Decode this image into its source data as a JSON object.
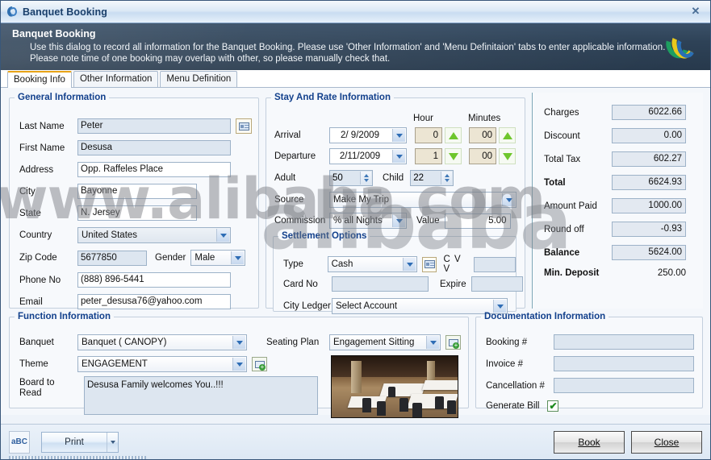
{
  "window": {
    "title": "Banquet Booking",
    "close_label": "✕",
    "logo_icon": "crescent-logo-icon"
  },
  "banner": {
    "heading": "Banquet Booking",
    "line1": "Use this dialog to record all information for the Banquet Booking. Please use 'Other Information' and 'Menu Definitaion' tabs to enter applicable information.",
    "line2": "Please note time of one booking may overlap with other, so please manually check that."
  },
  "tabs": [
    {
      "label": "Booking Info",
      "active": true
    },
    {
      "label": "Other Information",
      "active": false
    },
    {
      "label": "Menu Definition",
      "active": false
    }
  ],
  "general_information": {
    "legend": "General Information",
    "labels": {
      "last_name": "Last Name",
      "first_name": "First Name",
      "address": "Address",
      "city": "City",
      "state": "State",
      "country": "Country",
      "zip_code": "Zip Code",
      "gender": "Gender",
      "phone_no": "Phone No",
      "email": "Email"
    },
    "values": {
      "last_name": "Peter",
      "first_name": "Desusa",
      "address": "Opp. Raffeles Place",
      "city": "Bayonne",
      "state": "N. Jersey",
      "country": "United States",
      "zip_code": "5677850",
      "gender": "Male",
      "phone_no": "(888) 896-5441",
      "email": "peter_desusa76@yahoo.com"
    },
    "lookup_icon": "address-card-lookup-icon"
  },
  "stay_and_rate": {
    "legend": "Stay And Rate Information",
    "column_headers": {
      "hour": "Hour",
      "minutes": "Minutes"
    },
    "labels": {
      "arrival": "Arrival",
      "departure": "Departure",
      "adult": "Adult",
      "child": "Child",
      "source": "Source",
      "commission": "Commission",
      "value": "Value"
    },
    "values": {
      "arrival_date": "2/ 9/2009",
      "arrival_hour": "0",
      "arrival_minutes": "00",
      "departure_date": "2/11/2009",
      "departure_hour": "1",
      "departure_minutes": "00",
      "adult": "50",
      "child": "22",
      "source": "Make My Trip",
      "commission": "% all Nights",
      "value": "5.00"
    }
  },
  "settlement": {
    "legend": "Settlement Options",
    "labels": {
      "type": "Type",
      "cvv": "C V V",
      "card_no": "Card No",
      "expire": "Expire",
      "city_ledger": "City Ledger"
    },
    "values": {
      "type": "Cash",
      "cvv": "",
      "card_no": "",
      "expire": "",
      "city_ledger": "Select Account"
    },
    "card_icon": "credit-card-icon"
  },
  "charges_panel": {
    "rows": [
      {
        "label": "Charges",
        "value": "6022.66",
        "bold": false
      },
      {
        "label": "Discount",
        "value": "0.00",
        "bold": false
      },
      {
        "label": "Total Tax",
        "value": "602.27",
        "bold": false
      },
      {
        "label": "Total",
        "value": "6624.93",
        "bold": true
      },
      {
        "label": "Amount Paid",
        "value": "1000.00",
        "bold": false
      },
      {
        "label": "Round off",
        "value": "-0.93",
        "bold": false
      },
      {
        "label": "Balance",
        "value": "5624.00",
        "bold": true
      }
    ],
    "min_deposit": {
      "label": "Min. Deposit",
      "value": "250.00"
    }
  },
  "function_information": {
    "legend": "Function Information",
    "labels": {
      "banquet": "Banquet",
      "theme": "Theme",
      "board_to_read": "Board to Read",
      "seating_plan": "Seating Plan"
    },
    "values": {
      "banquet": "Banquet ( CANOPY)",
      "theme": "ENGAGEMENT",
      "board_to_read": "Desusa Family welcomes You..!!!",
      "seating_plan": "Engagement Sitting"
    },
    "theme_add_icon": "add-theme-icon",
    "seating_add_icon": "add-seating-plan-icon",
    "seating_photo_alt": "banquet-hall-photo"
  },
  "documentation_information": {
    "legend": "Documentation Information",
    "labels": {
      "booking_no": "Booking #",
      "invoice_no": "Invoice #",
      "cancellation_no": "Cancellation #",
      "generate_bill": "Generate Bill"
    },
    "values": {
      "booking_no": "",
      "invoice_no": "",
      "cancellation_no": "",
      "generate_bill_checked": "✔"
    }
  },
  "footer": {
    "spellcheck_icon": "abc-spellcheck-icon",
    "spellcheck_label": "aBC",
    "print_label": "Print",
    "book_label": "Book",
    "close_label": "Close"
  },
  "watermark": {
    "main": "www.alibaba.com",
    "secondary": "alibaba"
  }
}
